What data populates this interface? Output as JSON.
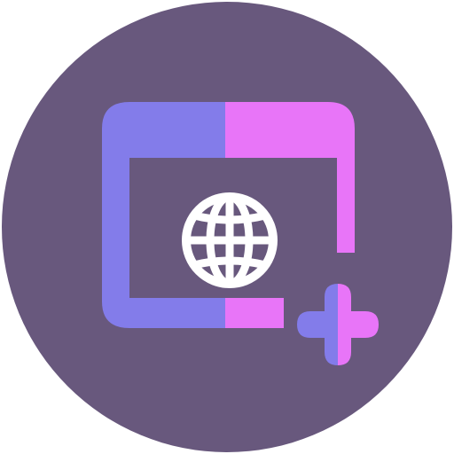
{
  "icon": {
    "name": "add-web-browser-window-icon",
    "colors": {
      "background_circle": "#68587D",
      "window_frame_left": "#837CEA",
      "window_frame_right": "#E875F8",
      "globe": "#FFFFFF",
      "plus_left": "#837CEA",
      "plus_right": "#E875F8"
    },
    "parts": {
      "background": "circle-background",
      "window": "browser-window-icon",
      "globe": "globe-icon",
      "plus": "plus-icon"
    }
  }
}
